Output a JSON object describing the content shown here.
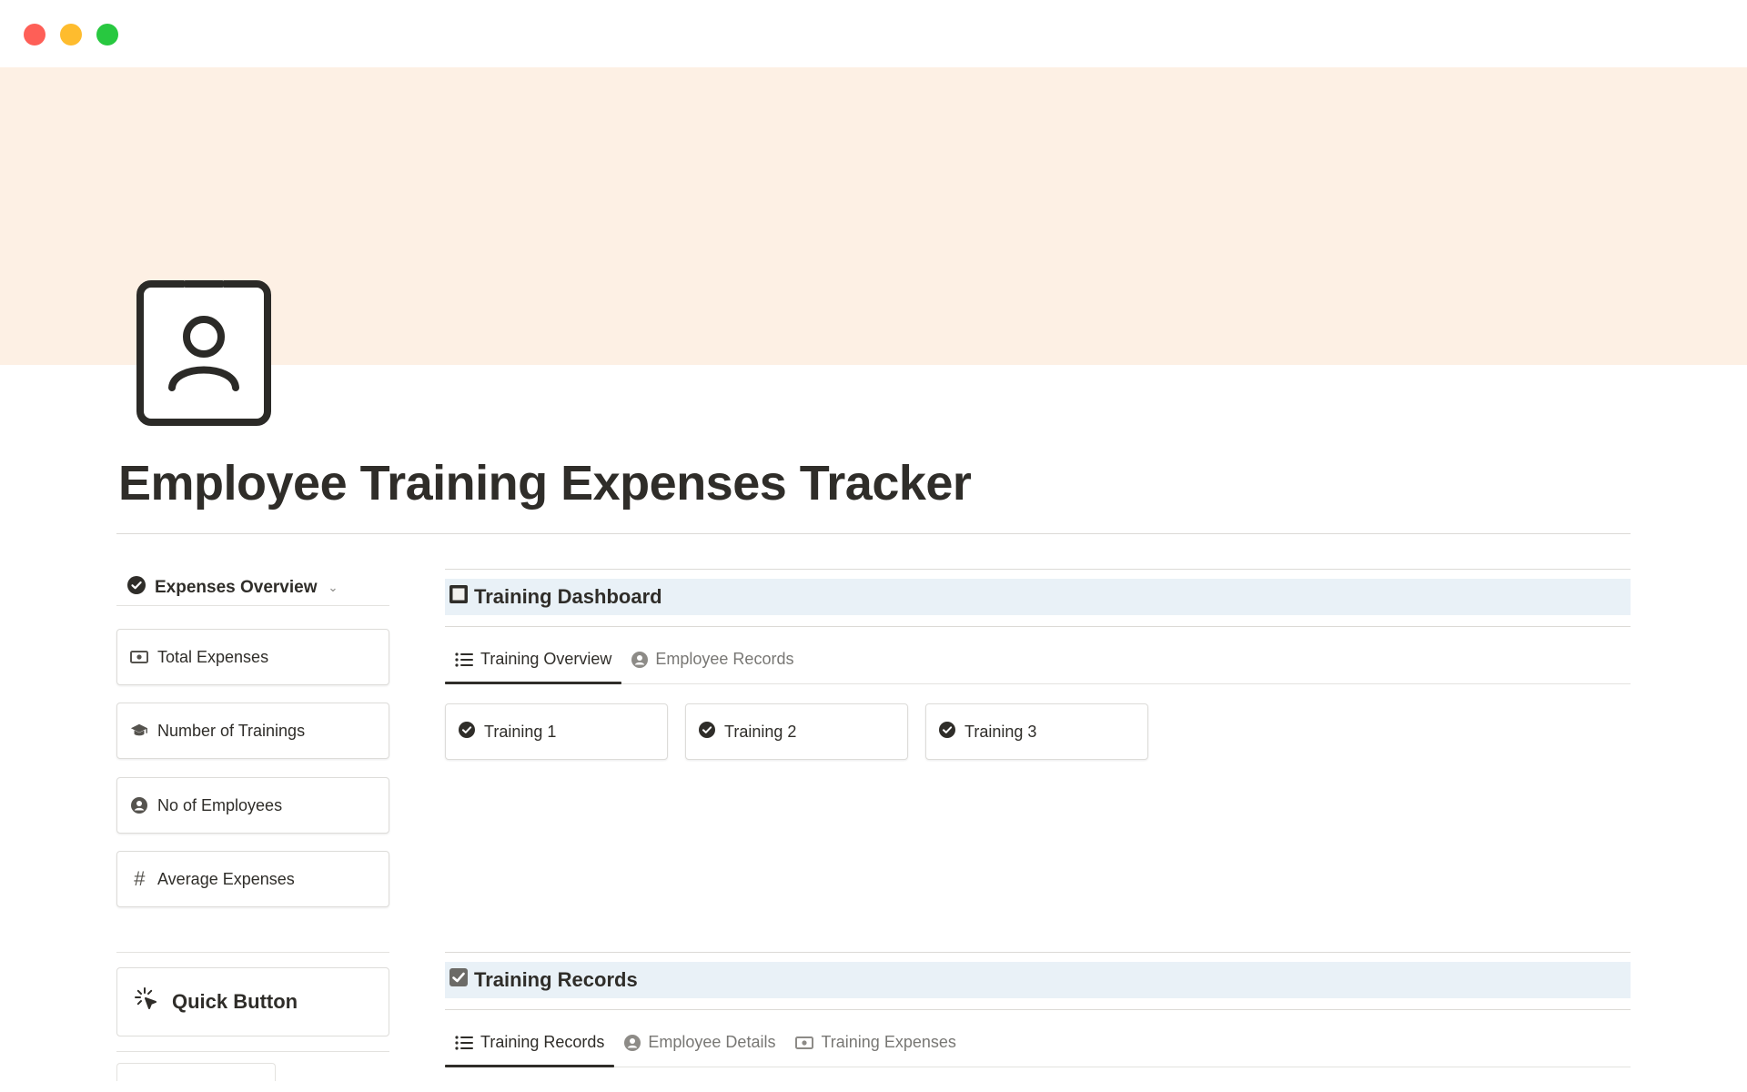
{
  "window": {
    "controls": [
      "close",
      "minimize",
      "zoom"
    ]
  },
  "colors": {
    "cover": "#fdf0e4",
    "section_header_bg": "#e9f1f7",
    "text_primary": "#2f2d29",
    "text_muted": "#787774",
    "close": "#fe5f57",
    "minimize": "#febc2e",
    "zoom": "#28c840"
  },
  "page": {
    "icon": "person-badge-icon",
    "title": "Employee Training Expenses Tracker"
  },
  "left": {
    "db_switch": {
      "icon": "check-circle-icon",
      "label": "Expenses Overview"
    },
    "stats": [
      {
        "icon": "banknote-icon",
        "label": "Total Expenses"
      },
      {
        "icon": "graduation-cap-icon",
        "label": "Number of Trainings"
      },
      {
        "icon": "user-circle-icon",
        "label": "No of Employees"
      },
      {
        "icon": "hash-icon",
        "label": "Average Expenses"
      }
    ],
    "quick_button": {
      "icon": "sparkle-cursor-icon",
      "label": "Quick Button"
    }
  },
  "dashboard": {
    "icon": "square-icon",
    "title": "Training Dashboard",
    "tabs": [
      {
        "icon": "list-icon",
        "label": "Training Overview",
        "active": true
      },
      {
        "icon": "user-circle-icon",
        "label": "Employee Records",
        "active": false
      }
    ],
    "cards": [
      {
        "icon": "check-circle-icon",
        "label": "Training 1"
      },
      {
        "icon": "check-circle-icon",
        "label": "Training 2"
      },
      {
        "icon": "check-circle-icon",
        "label": "Training 3"
      }
    ]
  },
  "records": {
    "icon": "checkbox-checked-icon",
    "title": "Training Records",
    "tabs": [
      {
        "icon": "list-icon",
        "label": "Training Records",
        "active": true
      },
      {
        "icon": "user-circle-icon",
        "label": "Employee Details",
        "active": false
      },
      {
        "icon": "banknote-icon",
        "label": "Training Expenses",
        "active": false
      }
    ]
  }
}
